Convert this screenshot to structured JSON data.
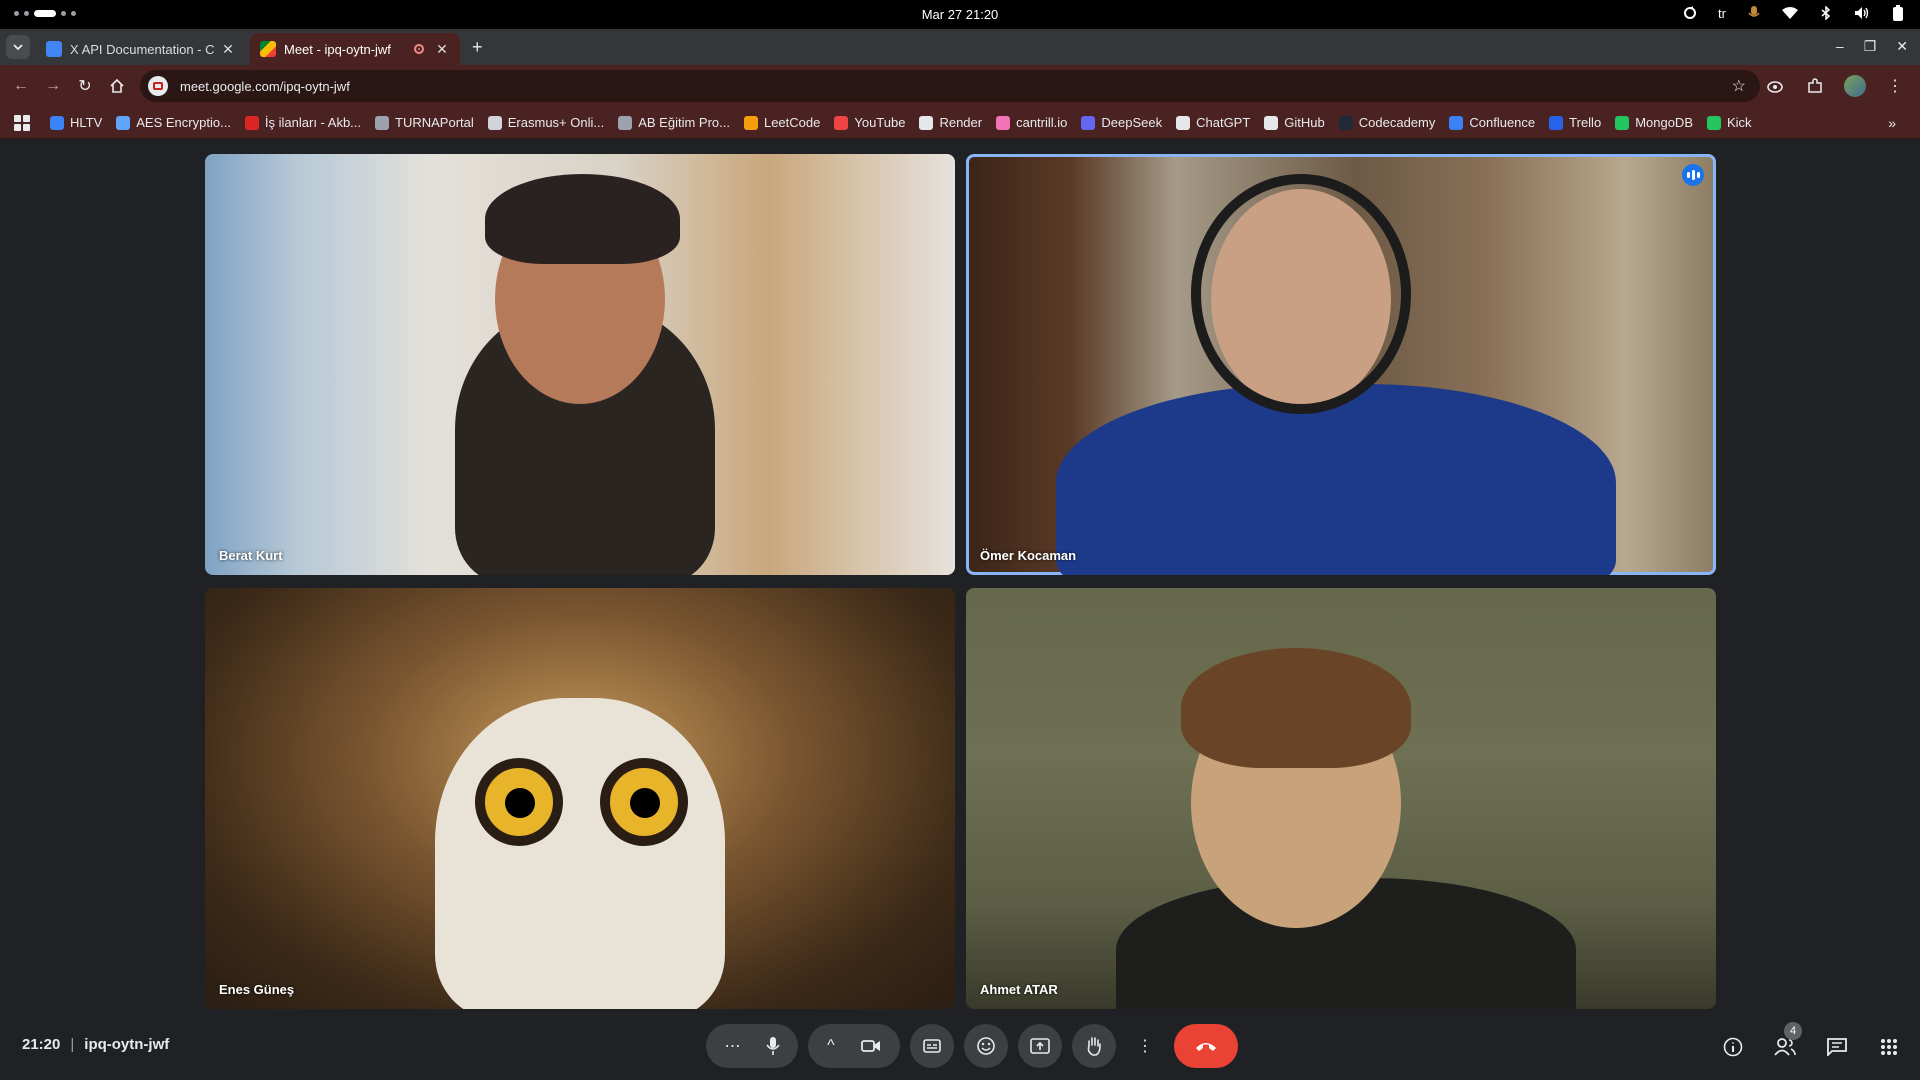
{
  "system": {
    "clock": "Mar 27  21:20",
    "keyboard_layout": "tr"
  },
  "browser": {
    "tabs": [
      {
        "title": "X API Documentation - C",
        "active": false
      },
      {
        "title": "Meet - ipq-oytn-jwf",
        "active": true
      }
    ],
    "url": "meet.google.com/ipq-oytn-jwf",
    "bookmarks": [
      {
        "label": "HLTV",
        "color": "#3b82f6"
      },
      {
        "label": "AES Encryptio...",
        "color": "#60a5fa"
      },
      {
        "label": "İş ilanları - Akb...",
        "color": "#dc2626"
      },
      {
        "label": "TURNAPortal",
        "color": "#9ca3af"
      },
      {
        "label": "Erasmus+ Onli...",
        "color": "#d1d5db"
      },
      {
        "label": "AB Eğitim Pro...",
        "color": "#9ca3af"
      },
      {
        "label": "LeetCode",
        "color": "#f59e0b"
      },
      {
        "label": "YouTube",
        "color": "#ef4444"
      },
      {
        "label": "Render",
        "color": "#e5e7eb"
      },
      {
        "label": "cantrill.io",
        "color": "#f472b6"
      },
      {
        "label": "DeepSeek",
        "color": "#6366f1"
      },
      {
        "label": "ChatGPT",
        "color": "#e5e7eb"
      },
      {
        "label": "GitHub",
        "color": "#e5e7eb"
      },
      {
        "label": "Codecademy",
        "color": "#1f2937"
      },
      {
        "label": "Confluence",
        "color": "#3b82f6"
      },
      {
        "label": "Trello",
        "color": "#2563eb"
      },
      {
        "label": "MongoDB",
        "color": "#22c55e"
      },
      {
        "label": "Kick",
        "color": "#22c55e"
      }
    ]
  },
  "meet": {
    "participants": [
      {
        "name": "Berat Kurt",
        "speaking": false
      },
      {
        "name": "Ömer Kocaman",
        "speaking": true
      },
      {
        "name": "Enes Güneş",
        "speaking": false
      },
      {
        "name": "Ahmet ATAR",
        "speaking": false
      }
    ],
    "footer": {
      "time": "21:20",
      "separator": "|",
      "meeting_code": "ipq-oytn-jwf",
      "participant_count": "4"
    },
    "hangup_color": "#ea4335",
    "speaking_color": "#8ab4f8"
  }
}
